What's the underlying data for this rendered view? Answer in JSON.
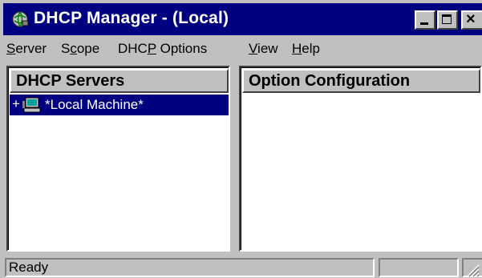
{
  "window": {
    "title": "DHCP Manager - (Local)",
    "icon": "dhcp-globe-icon",
    "controls": {
      "minimize": "minimize-icon",
      "maximize": "maximize-icon",
      "close_glyph": "×"
    }
  },
  "menu": {
    "items": [
      {
        "label": "Server",
        "accel": "S"
      },
      {
        "label": "Scope",
        "accel": "c"
      },
      {
        "label": "DHCP Options",
        "accel": "P"
      },
      {
        "label": "View",
        "accel": "V"
      },
      {
        "label": "Help",
        "accel": "H"
      }
    ]
  },
  "servers_panel": {
    "header": "DHCP Servers",
    "tree": [
      {
        "expander": "+",
        "icon": "computer-icon",
        "label": "*Local Machine*",
        "selected": true
      }
    ]
  },
  "options_panel": {
    "header": "Option Configuration"
  },
  "status": {
    "text": "Ready"
  },
  "colors": {
    "titlebar": "#000080",
    "selection": "#000080",
    "face": "#c0c0c0"
  }
}
